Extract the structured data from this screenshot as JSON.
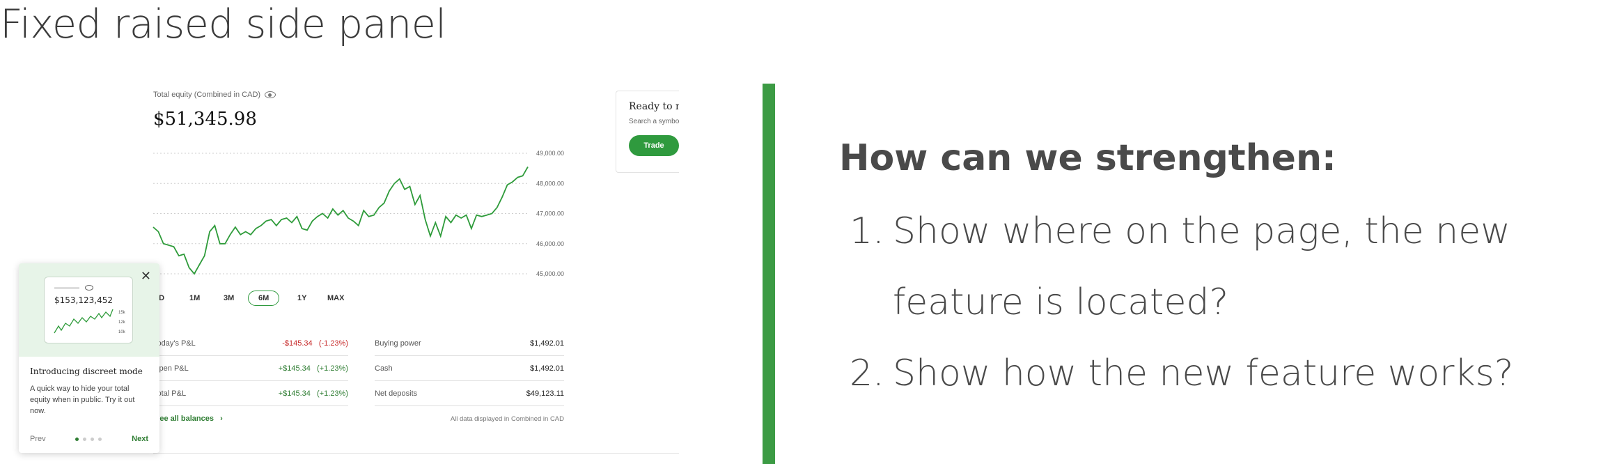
{
  "slide": {
    "title": "Fixed raised side panel",
    "question": "How can we strengthen:",
    "items": [
      {
        "number": "1.",
        "line1": "Show where on the page, the new",
        "line2": "feature is located?"
      },
      {
        "number": "2.",
        "line1": "Show how the new feature works?"
      }
    ],
    "divider_color": "#3c9b44"
  },
  "app": {
    "equity_label": "Total equity (Combined in CAD)",
    "equity_value": "$51,345.98",
    "ready_card": {
      "title": "Ready to m",
      "subtitle": "Search a symbo",
      "trade_label": "Trade"
    },
    "chart_data": {
      "type": "line",
      "y_ticks": [
        "49,000.00",
        "48,000.00",
        "47,000.00",
        "46,000.00",
        "45,000.00"
      ],
      "ylim": [
        45000,
        49000
      ],
      "values": [
        46550,
        46400,
        46000,
        45950,
        45900,
        45600,
        45650,
        45200,
        45000,
        45300,
        45600,
        46400,
        46600,
        46000,
        46000,
        46300,
        46550,
        46300,
        46400,
        46300,
        46500,
        46600,
        46750,
        46800,
        46600,
        46800,
        46850,
        46700,
        46900,
        46500,
        46450,
        46750,
        46900,
        47000,
        46850,
        47150,
        46950,
        47100,
        46850,
        46750,
        46600,
        47100,
        46900,
        46950,
        47200,
        47350,
        47750,
        48000,
        48150,
        47800,
        47900,
        47300,
        47600,
        46800,
        46250,
        46700,
        46250,
        46900,
        46700,
        46950,
        46850,
        46950,
        46500,
        46950,
        46900,
        46950,
        47000,
        47200,
        47550,
        47950,
        48050,
        48200,
        48250,
        48550
      ],
      "color": "#2e9b3a",
      "grid": true
    },
    "ranges": [
      "5D",
      "1M",
      "3M",
      "6M",
      "1Y",
      "MAX"
    ],
    "active_range": "6M",
    "stats_left": [
      {
        "label": "Today's P&L",
        "value": "-$145.34   (-1.23%)",
        "tone": "neg"
      },
      {
        "label": "Open P&L",
        "value": "+$145.34   (+1.23%)",
        "tone": "pos"
      },
      {
        "label": "Total P&L",
        "value": "+$145.34   (+1.23%)",
        "tone": "pos"
      }
    ],
    "stats_right": [
      {
        "label": "Buying power",
        "value": "$1,492.01"
      },
      {
        "label": "Cash",
        "value": "$1,492.01"
      },
      {
        "label": "Net deposits",
        "value": "$49,123.11"
      }
    ],
    "see_all": "See all balances",
    "note": "All data displayed in Combined in CAD",
    "popover": {
      "mini_value": "$153,123,452",
      "mini_ticks": [
        "15k",
        "12k",
        "10k"
      ],
      "title": "Introducing discreet mode",
      "text": "A quick way to hide your total equity when in public. Try it out now.",
      "prev": "Prev",
      "next": "Next",
      "step": 1,
      "steps": 4
    }
  }
}
